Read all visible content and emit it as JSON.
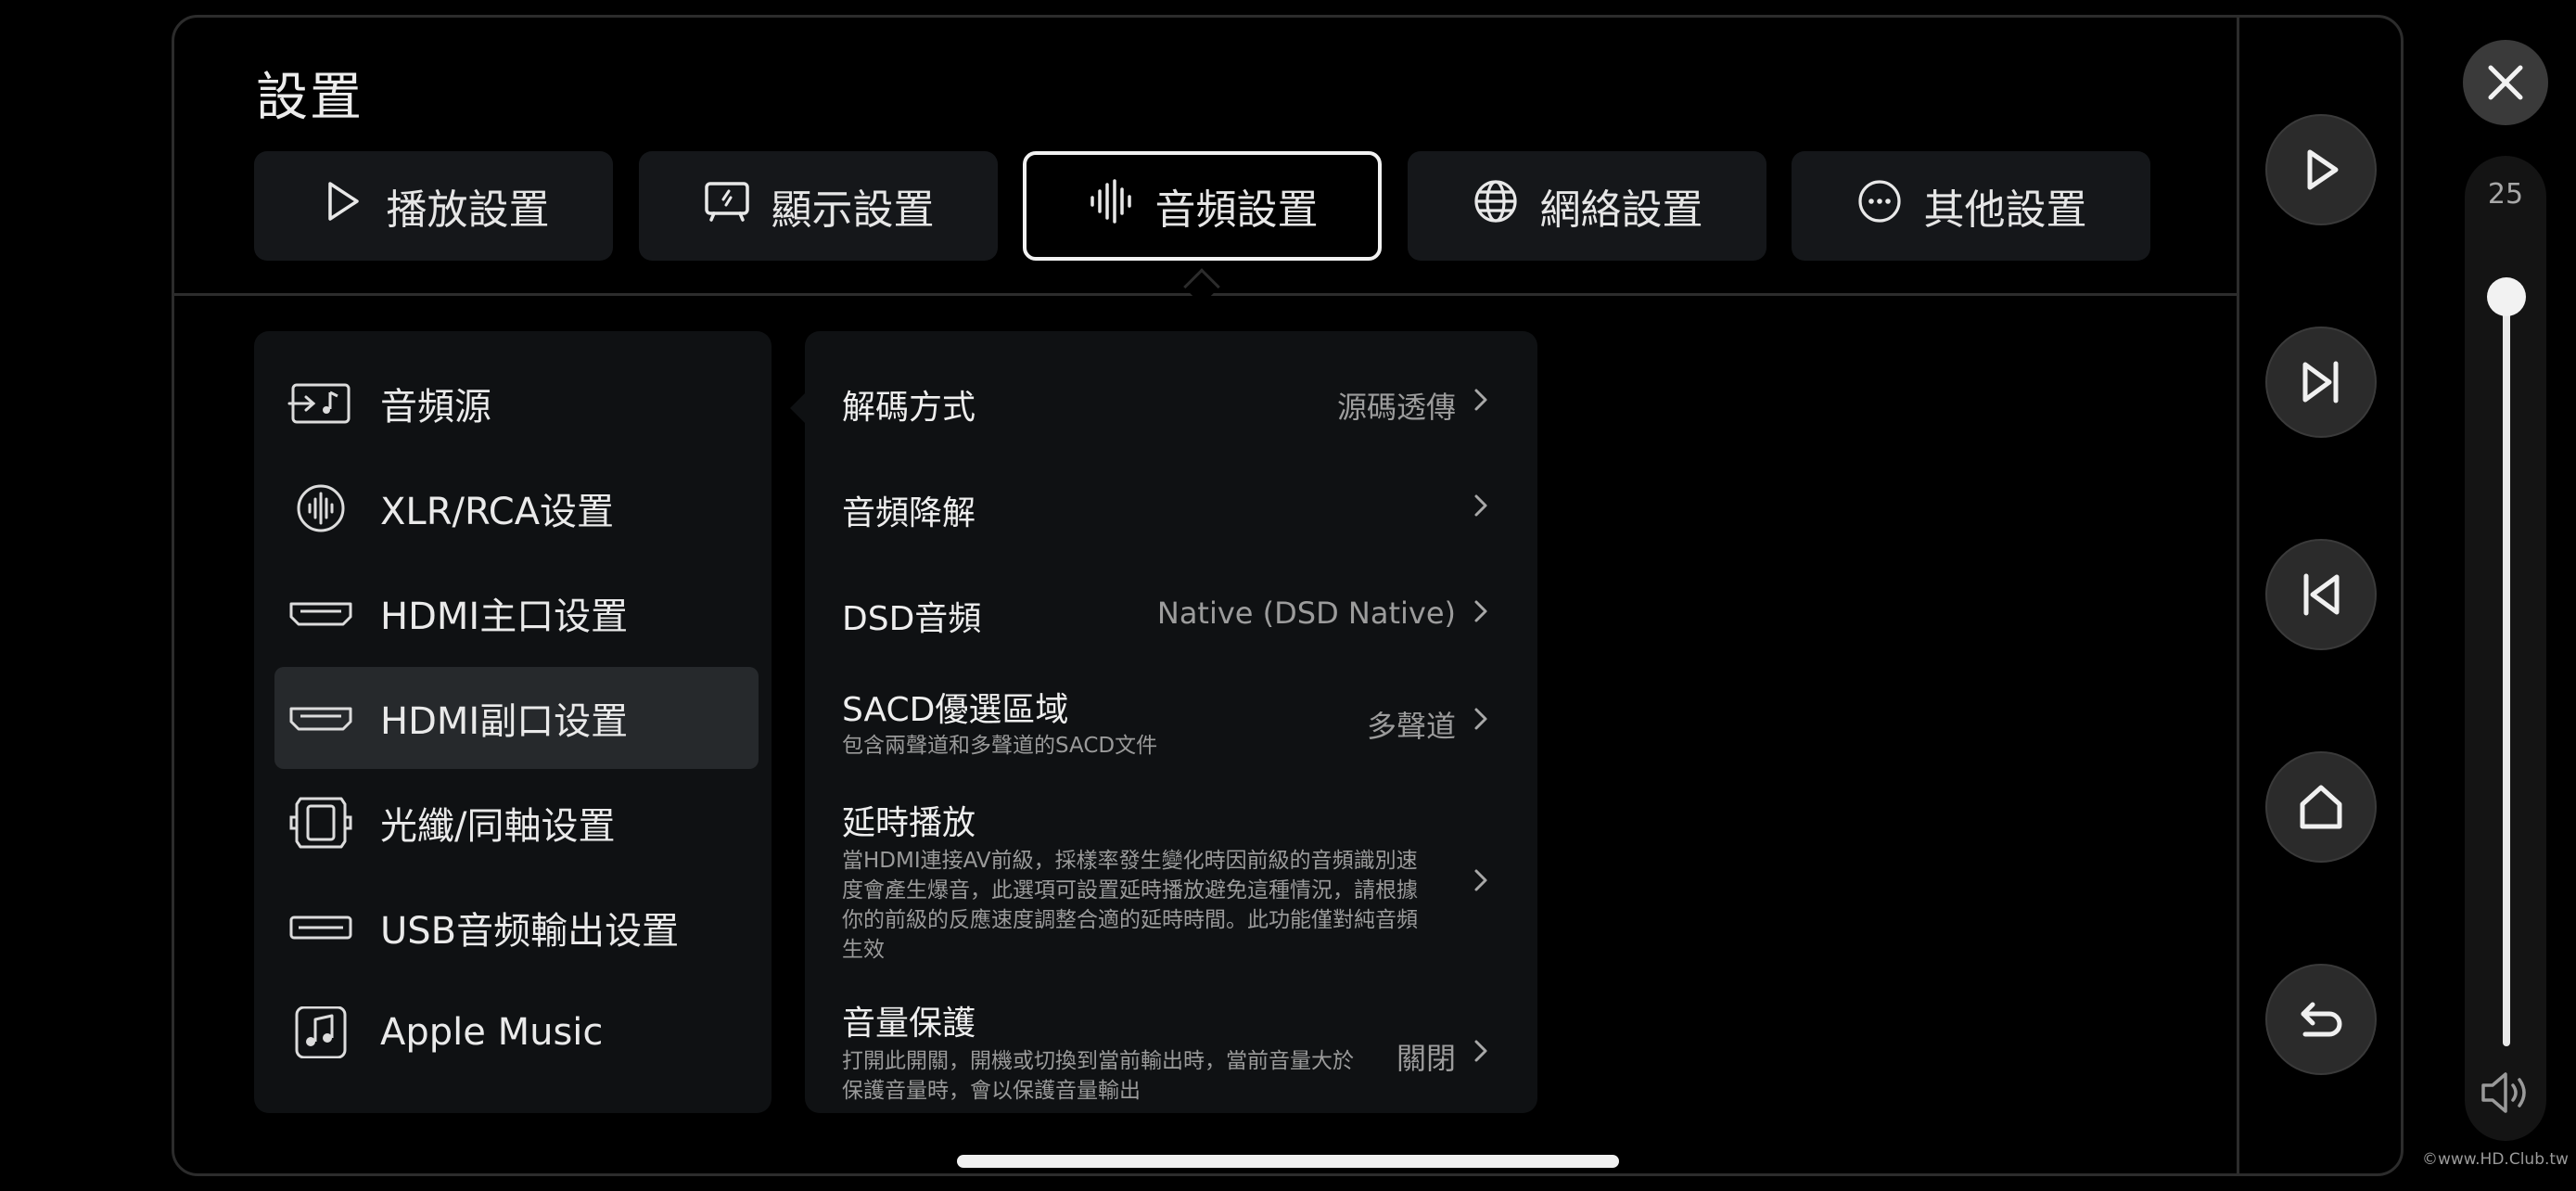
{
  "settings": {
    "title": "設置"
  },
  "tabs": [
    {
      "label": "播放設置",
      "icon": "play-icon"
    },
    {
      "label": "顯示設置",
      "icon": "display-icon"
    },
    {
      "label": "音頻設置",
      "icon": "audio-wave-icon",
      "active": true
    },
    {
      "label": "網絡設置",
      "icon": "globe-icon"
    },
    {
      "label": "其他設置",
      "icon": "more-icon"
    }
  ],
  "audio_menu": [
    {
      "label": "音頻源",
      "icon": "audio-source-icon"
    },
    {
      "label": "XLR/RCA设置",
      "icon": "xlr-rca-icon"
    },
    {
      "label": "HDMI主口设置",
      "icon": "hdmi-port-icon"
    },
    {
      "label": "HDMI副口设置",
      "icon": "hdmi-port-icon",
      "selected": true
    },
    {
      "label": "光纖/同軸设置",
      "icon": "optical-coax-icon"
    },
    {
      "label": "USB音频輸出设置",
      "icon": "usb-port-icon"
    },
    {
      "label": "Apple Music",
      "icon": "music-note-icon"
    }
  ],
  "options": [
    {
      "label": "解碼方式",
      "value": "源碼透傳"
    },
    {
      "label": "音頻降解",
      "value": ""
    },
    {
      "label": "DSD音頻",
      "value": "Native (DSD Native)"
    },
    {
      "label": "SACD優選區域",
      "desc": "包含兩聲道和多聲道的SACD文件",
      "value": "多聲道"
    },
    {
      "label": "延時播放",
      "desc1": "當HDMI連接AV前級，採樣率發生變化時因前級的音頻識別速",
      "desc2": "度會產生爆音，此選項可設置延時播放避免這種情況，請根據",
      "desc3": "你的前級的反應速度調整合適的延時時間。此功能僅對純音頻",
      "desc4": "生效",
      "value": ""
    },
    {
      "label": "音量保護",
      "desc1": "打開此開關，開機或切換到當前輸出時，當前音量大於",
      "desc2": "保護音量時，會以保護音量輸出",
      "value": "關閉"
    }
  ],
  "side_controls": [
    "play-icon",
    "skip-next-icon",
    "skip-previous-icon",
    "home-icon",
    "back-icon"
  ],
  "volume": {
    "value": "25",
    "level": 0.25,
    "icon": "speaker-icon"
  },
  "close_icon": "close-icon",
  "watermark": "©www.HD.Club.tw",
  "colors": {
    "background": "#000000",
    "card": "#0f1113",
    "tab": "#15171a",
    "selected": "#26292c",
    "accent": "#f2f2f2"
  }
}
